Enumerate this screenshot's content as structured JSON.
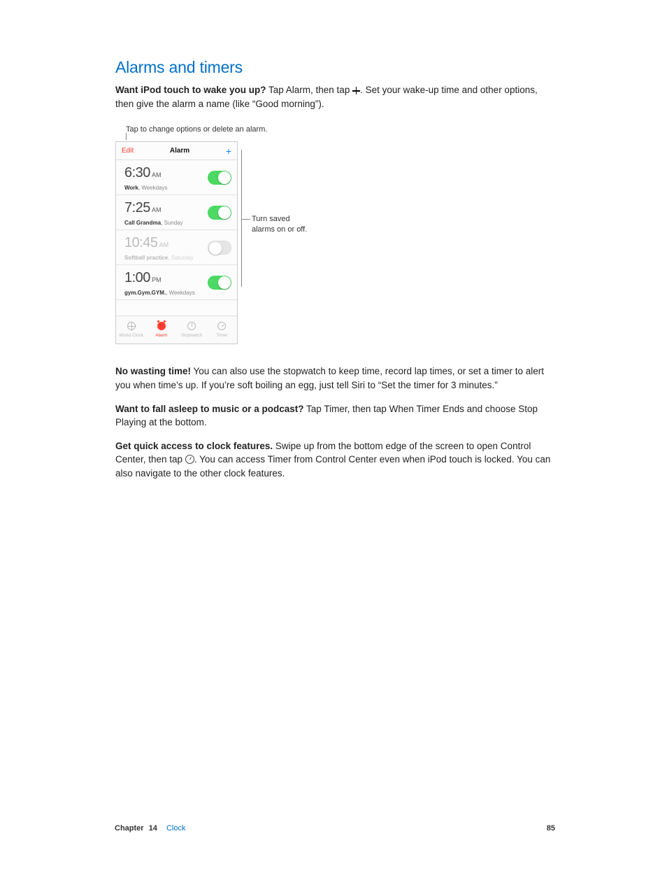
{
  "heading": "Alarms and timers",
  "para1_lede": "Want iPod touch to wake you up?",
  "para1_rest_a": " Tap Alarm, then tap ",
  "para1_rest_b": ". Set your wake-up time and other options, then give the alarm a name (like “Good morning”).",
  "callouts": {
    "top": "Tap to change options or delete an alarm.",
    "right1": "Turn saved",
    "right2": "alarms on or off."
  },
  "alarm_screen": {
    "edit": "Edit",
    "title": "Alarm",
    "add": "+",
    "rows": [
      {
        "time": "6:30",
        "ampm": "AM",
        "label": "Work",
        "repeat": "Weekdays",
        "on": true
      },
      {
        "time": "7:25",
        "ampm": "AM",
        "label": "Call Grandma",
        "repeat": "Sunday",
        "on": true
      },
      {
        "time": "10:45",
        "ampm": "AM",
        "label": "Softball practice",
        "repeat": "Saturday",
        "on": false
      },
      {
        "time": "1:00",
        "ampm": "PM",
        "label": "gym.Gym.GYM.",
        "repeat": "Weekdays",
        "on": true
      }
    ],
    "tabs": {
      "world": "World Clock",
      "alarm": "Alarm",
      "stopwatch": "Stopwatch",
      "timer": "Timer"
    }
  },
  "para2_lede": "No wasting time!",
  "para2_rest": " You can also use the stopwatch to keep time, record lap times, or set a timer to alert you when time’s up. If you’re soft boiling an egg, just tell Siri to “Set the timer for 3 minutes.”",
  "para3_lede": "Want to fall asleep to music or a podcast?",
  "para3_rest": " Tap Timer, then tap When Timer Ends and choose Stop Playing at the bottom.",
  "para4_lede": "Get quick access to clock features.",
  "para4_rest_a": " Swipe up from the bottom edge of the screen to open Control Center, then tap ",
  "para4_rest_b": ". You can access Timer from Control Center even when iPod touch is locked. You can also navigate to the other clock features.",
  "footer": {
    "chapter_word": "Chapter",
    "chapter_num": "14",
    "chapter_title": "Clock",
    "page": "85"
  }
}
